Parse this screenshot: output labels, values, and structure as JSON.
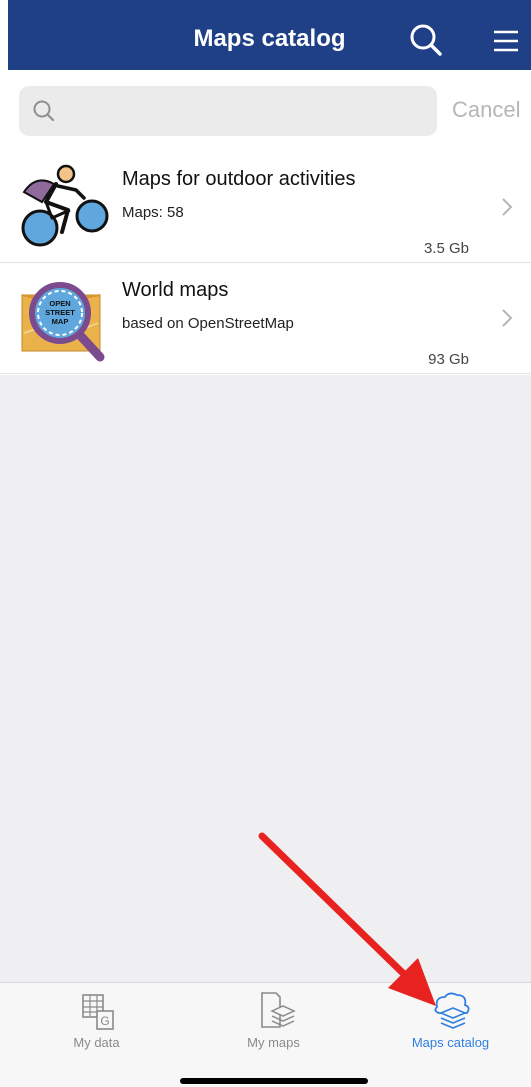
{
  "header": {
    "title": "Maps catalog",
    "search_icon": "search-icon",
    "menu_icon": "hamburger-menu-icon"
  },
  "search": {
    "placeholder": "",
    "value": "",
    "cancel_label": "Cancel"
  },
  "catalog": {
    "items": [
      {
        "title": "Maps for outdoor activities",
        "subtitle": "Maps: 58",
        "size": "3.5 Gb",
        "icon": "cyclist-icon"
      },
      {
        "title": "World maps",
        "subtitle": "based on OpenStreetMap",
        "size": "93 Gb",
        "icon": "openstreetmap-logo",
        "logo_text": "OPEN STREET MAP"
      }
    ]
  },
  "tabs": [
    {
      "label": "My data",
      "icon": "my-data-icon",
      "active": false
    },
    {
      "label": "My maps",
      "icon": "my-maps-icon",
      "active": false
    },
    {
      "label": "Maps catalog",
      "icon": "maps-catalog-icon",
      "active": true
    }
  ],
  "colors": {
    "header_bg": "#1f3f87",
    "active_tab": "#2f7fe0",
    "arrow": "#e8231f"
  }
}
